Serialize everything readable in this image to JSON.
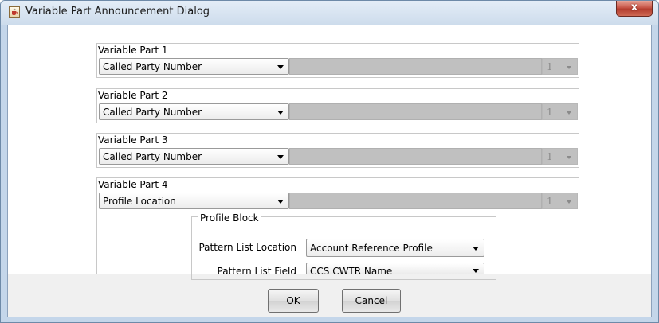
{
  "window": {
    "title": "Variable Part Announcement Dialog",
    "close_symbol": "x"
  },
  "icons": {
    "app": "java-cup-icon",
    "close": "close-icon",
    "dropdown": "chevron-down-icon"
  },
  "variable_parts": [
    {
      "label": "Variable Part 1",
      "type_value": "Called Party Number",
      "number_value": "1"
    },
    {
      "label": "Variable Part 2",
      "type_value": "Called Party Number",
      "number_value": "1"
    },
    {
      "label": "Variable Part 3",
      "type_value": "Called Party Number",
      "number_value": "1"
    },
    {
      "label": "Variable Part 4",
      "type_value": "Profile Location",
      "number_value": "1"
    }
  ],
  "profile_block": {
    "title": "Profile Block",
    "pattern_list_location": {
      "label": "Pattern List Location",
      "value": "Account Reference Profile"
    },
    "pattern_list_field": {
      "label": "Pattern List Field",
      "value": "CCS CWTR Name"
    }
  },
  "buttons": {
    "ok": "OK",
    "cancel": "Cancel"
  },
  "colors": {
    "close_button": "#c75648",
    "disabled_field": "#c0c0c0",
    "dialog_background": "#f0f0f0"
  }
}
